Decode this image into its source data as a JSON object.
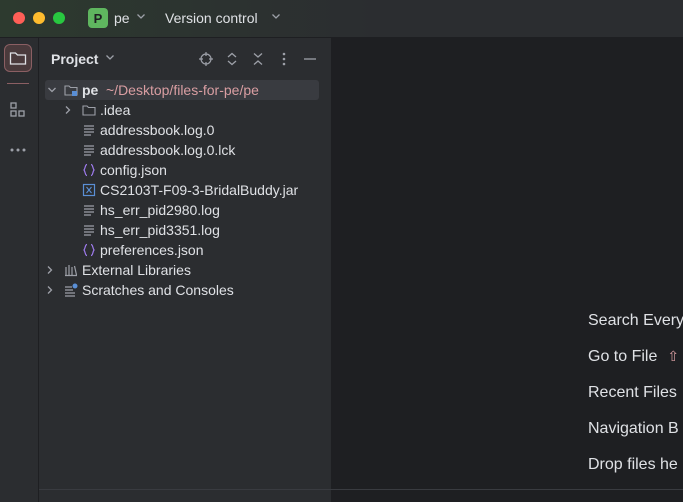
{
  "titlebar": {
    "project_badge": "P",
    "project_name": "pe",
    "vcs_label": "Version control"
  },
  "toolstrip": {
    "items": [
      {
        "name": "project",
        "icon": "folder-icon"
      },
      {
        "name": "structure",
        "icon": "structure-icon"
      },
      {
        "name": "more",
        "icon": "more-icon"
      }
    ]
  },
  "panel": {
    "title": "Project"
  },
  "tree": {
    "root_name": "pe",
    "root_path": "~/Desktop/files-for-pe/pe",
    "items": [
      {
        "label": ".idea",
        "type": "folder"
      },
      {
        "label": "addressbook.log.0",
        "type": "text"
      },
      {
        "label": "addressbook.log.0.lck",
        "type": "text"
      },
      {
        "label": "config.json",
        "type": "json"
      },
      {
        "label": "CS2103T-F09-3-BridalBuddy.jar",
        "type": "jar"
      },
      {
        "label": "hs_err_pid2980.log",
        "type": "text"
      },
      {
        "label": "hs_err_pid3351.log",
        "type": "text"
      },
      {
        "label": "preferences.json",
        "type": "json"
      }
    ],
    "external_libraries": "External Libraries",
    "scratches": "Scratches and Consoles"
  },
  "editor": {
    "hints": [
      {
        "label": "Search Every"
      },
      {
        "label": "Go to File",
        "shortcut": "⇧"
      },
      {
        "label": "Recent Files"
      },
      {
        "label": "Navigation B"
      },
      {
        "label": "Drop files he"
      }
    ]
  },
  "colors": {
    "accent_badge": "#5fb65f",
    "path_text": "#d99ea2",
    "json_icon": "#a07cf0",
    "jar_icon": "#5a8fd6"
  }
}
